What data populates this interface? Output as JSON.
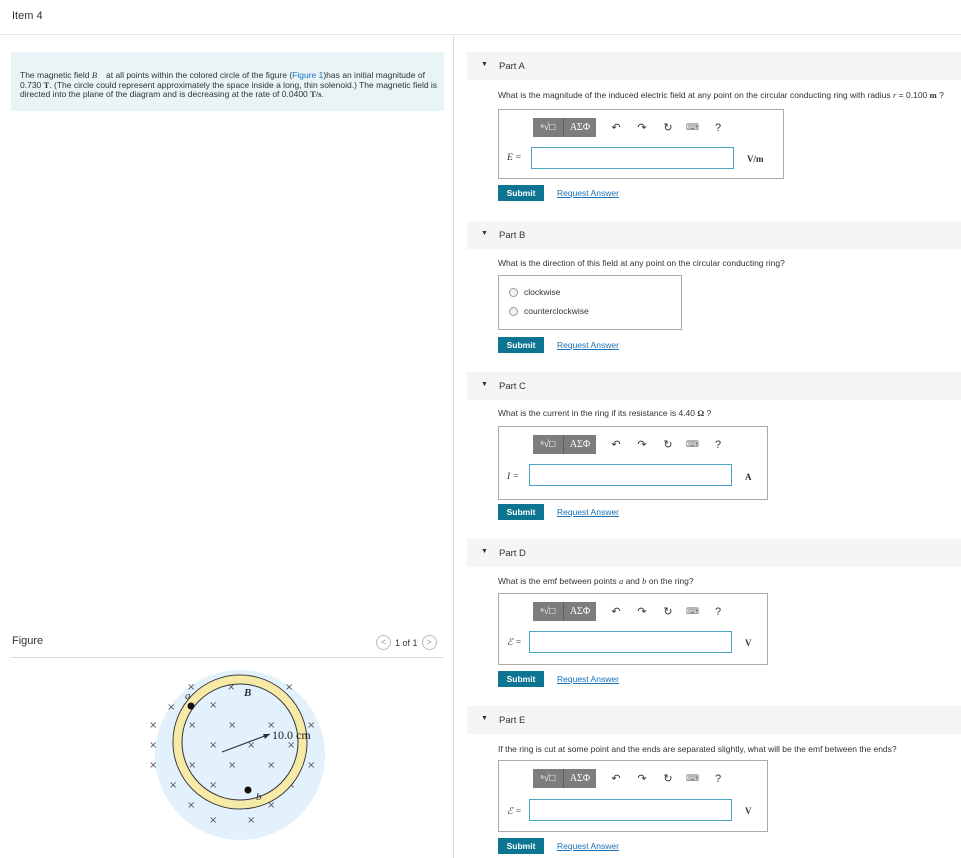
{
  "item_title": "Item 4",
  "problem": {
    "text1": "The magnetic field ",
    "b_symbol": "B⃗",
    "text2": " at all points within the colored circle of the figure (",
    "figure_link": "Figure 1",
    "text3": ")has an initial magnitude of 0.730 ",
    "unit_T": "T",
    "text4": ". (The circle could represent approximately the space inside a long, thin solenoid.) The magnetic field is directed into the plane of the diagram and is decreasing at the rate of 0.0400 ",
    "unit_Ts": "T/s",
    "text5": "."
  },
  "figure": {
    "label": "Figure",
    "pager": "1 of 1",
    "prev_symbol": "<",
    "next_symbol": ">",
    "b_label": "B⃗",
    "point_a": "a",
    "point_b": "b",
    "radius_label": "10.0 cm",
    "cross": "×",
    "field_color": "#e2f1fb",
    "ring_color": "#f6eaa6"
  },
  "toolbar": {
    "radical": "ⁿ√□",
    "greek": "ΑΣΦ",
    "undo": "↶",
    "redo": "↷",
    "reset": "↻",
    "keyboard": "⌨",
    "help": "?"
  },
  "parts": [
    {
      "id": "A",
      "title": "Part A",
      "question_pre": "What is the magnitude of the induced electric field at any point on the circular conducting ring with radius ",
      "question_var": "r",
      "question_post": " = 0.100 ",
      "question_unit": "m",
      "question_end": " ?",
      "var": "E =",
      "unit": "V/m",
      "value": ""
    },
    {
      "id": "B",
      "title": "Part B",
      "question": "What is the direction of this field at any point on the circular conducting ring?",
      "options": [
        "clockwise",
        "counterclockwise"
      ]
    },
    {
      "id": "C",
      "title": "Part C",
      "question_pre": "What is the current in the ring if its resistance is 4.40 ",
      "question_unit": "Ω",
      "question_end": " ?",
      "var": "I =",
      "unit": "A",
      "value": ""
    },
    {
      "id": "D",
      "title": "Part D",
      "question_pre": "What is the emf between points ",
      "question_a": "a",
      "question_mid": " and ",
      "question_b": "b",
      "question_end": " on the ring?",
      "var": "ℰ =",
      "unit": "V",
      "value": ""
    },
    {
      "id": "E",
      "title": "Part E",
      "question": "If the ring is cut at some point and the ends are separated slightly, what will be the emf between the ends?",
      "var": "ℰ =",
      "unit": "V",
      "value": ""
    }
  ],
  "buttons": {
    "submit": "Submit",
    "request": "Request Answer"
  }
}
